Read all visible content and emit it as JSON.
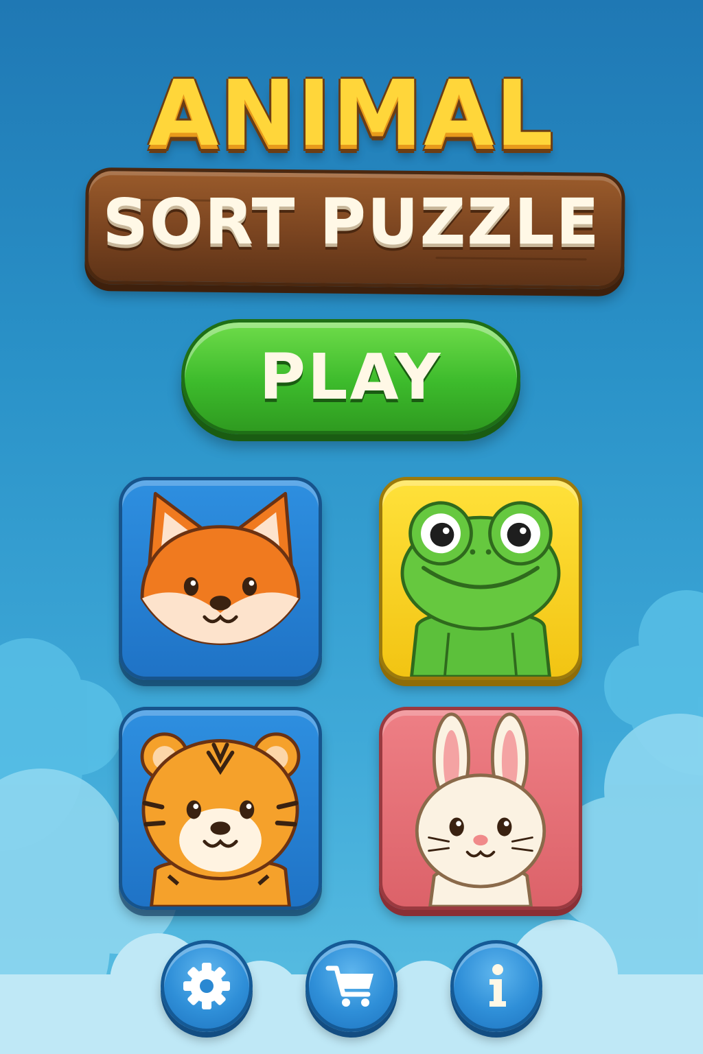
{
  "title": {
    "line1": "ANIMAL",
    "line2": "SORT PUZZLE"
  },
  "play_button": {
    "label": "PLAY"
  },
  "animal_tiles": [
    {
      "animal": "fox",
      "color": "#2a84d6"
    },
    {
      "animal": "frog",
      "color": "#f7cf20"
    },
    {
      "animal": "tiger",
      "color": "#2a84d6"
    },
    {
      "animal": "bunny",
      "color": "#e4707a"
    }
  ],
  "bottom_buttons": [
    {
      "icon": "gear-icon"
    },
    {
      "icon": "cart-icon"
    },
    {
      "icon": "info-icon"
    }
  ],
  "colors": {
    "background": "#2a92c8",
    "title_yellow": "#ffd63a",
    "plank_brown": "#7a4420",
    "play_green": "#3dbb2c"
  }
}
